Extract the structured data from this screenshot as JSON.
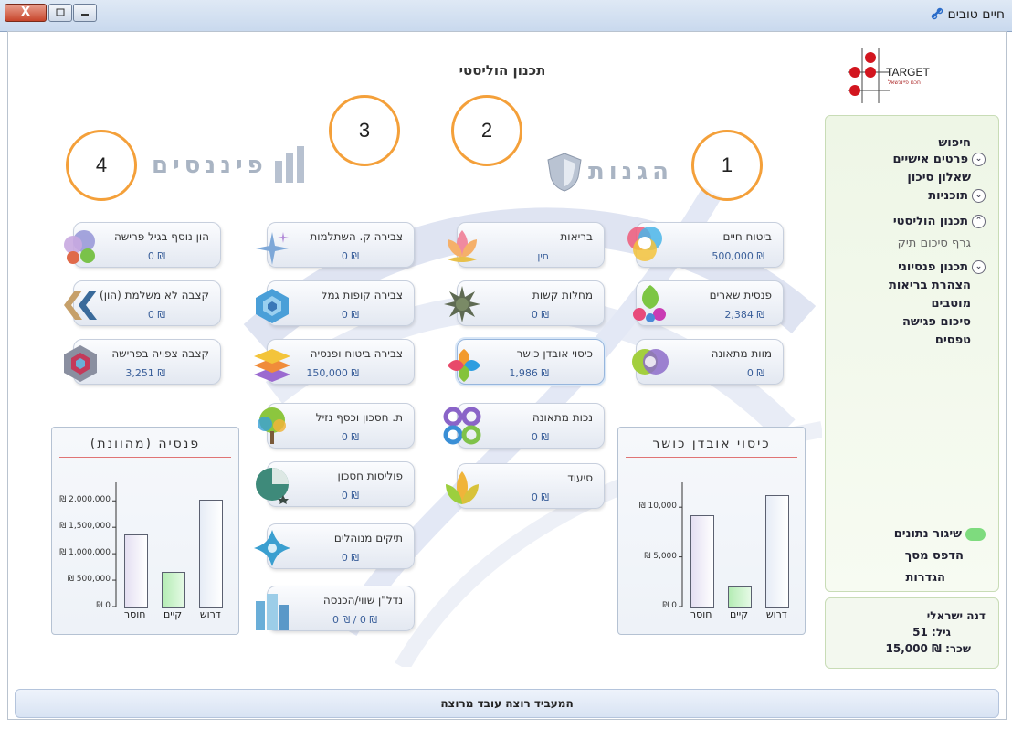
{
  "window": {
    "app_title": "חיים טובים",
    "close_glyph": "X"
  },
  "page": {
    "title": "תכנון הוליסטי",
    "logo_text": "TARGET",
    "logo_subtext": "חכם פייננשאל"
  },
  "markers": [
    "1",
    "2",
    "3",
    "4"
  ],
  "sections": {
    "protections": "הגנות",
    "finance": "פיננסים"
  },
  "tiles": {
    "protections_col1": [
      {
        "label": "ביטוח חיים",
        "value": "₪ 500,000"
      },
      {
        "label": "פנסית שארים",
        "value": "₪ 2,384"
      },
      {
        "label": "מוות מתאונה",
        "value": "₪ 0"
      }
    ],
    "protections_col2": [
      {
        "label": "בריאות",
        "value": "חין"
      },
      {
        "label": "מחלות קשות",
        "value": "₪ 0"
      },
      {
        "label": "כיסוי אובדן כושר",
        "value": "₪ 1,986"
      },
      {
        "label": "נכות מתאונה",
        "value": "₪ 0"
      },
      {
        "label": "סיעוד",
        "value": "₪ 0"
      }
    ],
    "finance_col": [
      {
        "label": "צבירה ק. השתלמות",
        "value": "₪ 0"
      },
      {
        "label": "צבירה קופות גמל",
        "value": "₪ 0"
      },
      {
        "label": "צבירה ביטוח ופנסיה",
        "value": "₪ 150,000"
      },
      {
        "label": "ת. חסכון וכסף נזיל",
        "value": "₪ 0"
      },
      {
        "label": "פוליסות חסכון",
        "value": "₪ 0"
      },
      {
        "label": "תיקים מנוהלים",
        "value": "₪ 0"
      },
      {
        "label": "נדל\"ן שווי/הכנסה",
        "value": "₪ 0 / ₪ 0"
      }
    ],
    "retirement_col": [
      {
        "label": "הון נוסף בגיל פרישה",
        "value": "₪ 0"
      },
      {
        "label": "קצבה לא משלמת (הון)",
        "value": "₪ 0"
      },
      {
        "label": "קצבה צפויה בפרישה",
        "value": "₪ 3,251"
      }
    ]
  },
  "sidebar": {
    "items": [
      {
        "label": "חיפוש",
        "chevron": "",
        "sub": false
      },
      {
        "label": "פרטים אישיים",
        "chevron": "⌄",
        "sub": false
      },
      {
        "label": "שאלון סיכון",
        "chevron": "",
        "sub": false
      },
      {
        "label": "תוכניות",
        "chevron": "⌄",
        "sub": false
      },
      {
        "label": "תכנון הוליסטי",
        "chevron": "⌃",
        "sub": false
      },
      {
        "label": "גרף סיכום תיק",
        "chevron": "",
        "sub": true
      },
      {
        "label": "תכנון פנסיוני",
        "chevron": "⌄",
        "sub": false
      },
      {
        "label": "הצהרת בריאות",
        "chevron": "",
        "sub": false
      },
      {
        "label": "מוטבים",
        "chevron": "",
        "sub": false
      },
      {
        "label": "סיכום פגישה",
        "chevron": "",
        "sub": false
      },
      {
        "label": "טפסים",
        "chevron": "",
        "sub": false
      }
    ],
    "bottom": {
      "sync": "שיגור נתונים",
      "print": "הדפס מסך",
      "settings": "הגדרות"
    },
    "sync_color": "#7edb7e"
  },
  "user": {
    "name": "דנה ישראלי",
    "age": "גיל: 51",
    "salary": "שכר: ₪ 15,000"
  },
  "status_bar": "המעביד רוצה עובד מרוצה",
  "chart_data": [
    {
      "type": "bar",
      "title": "כיסוי אובדן כושר",
      "categories": [
        "דרוש",
        "קיים",
        "חוסר"
      ],
      "values": [
        11200,
        1986,
        9214
      ],
      "ylim": [
        0,
        12500
      ],
      "yticks": [
        0,
        5000,
        10000
      ],
      "ytick_labels": [
        "₪ 0",
        "₪ 5,000",
        "₪ 10,000"
      ],
      "grid": false
    },
    {
      "type": "bar",
      "title": "פנסיה (מהוונת)",
      "categories": [
        "דרוש",
        "קיים",
        "חוסר"
      ],
      "values": [
        2020000,
        650000,
        1370000
      ],
      "ylim": [
        0,
        2350000
      ],
      "yticks": [
        0,
        500000,
        1000000,
        1500000,
        2000000
      ],
      "ytick_labels": [
        "₪ 0",
        "₪ 500,000",
        "₪ 1,000,000",
        "₪ 1,500,000",
        "₪ 2,000,000"
      ],
      "grid": false
    }
  ]
}
